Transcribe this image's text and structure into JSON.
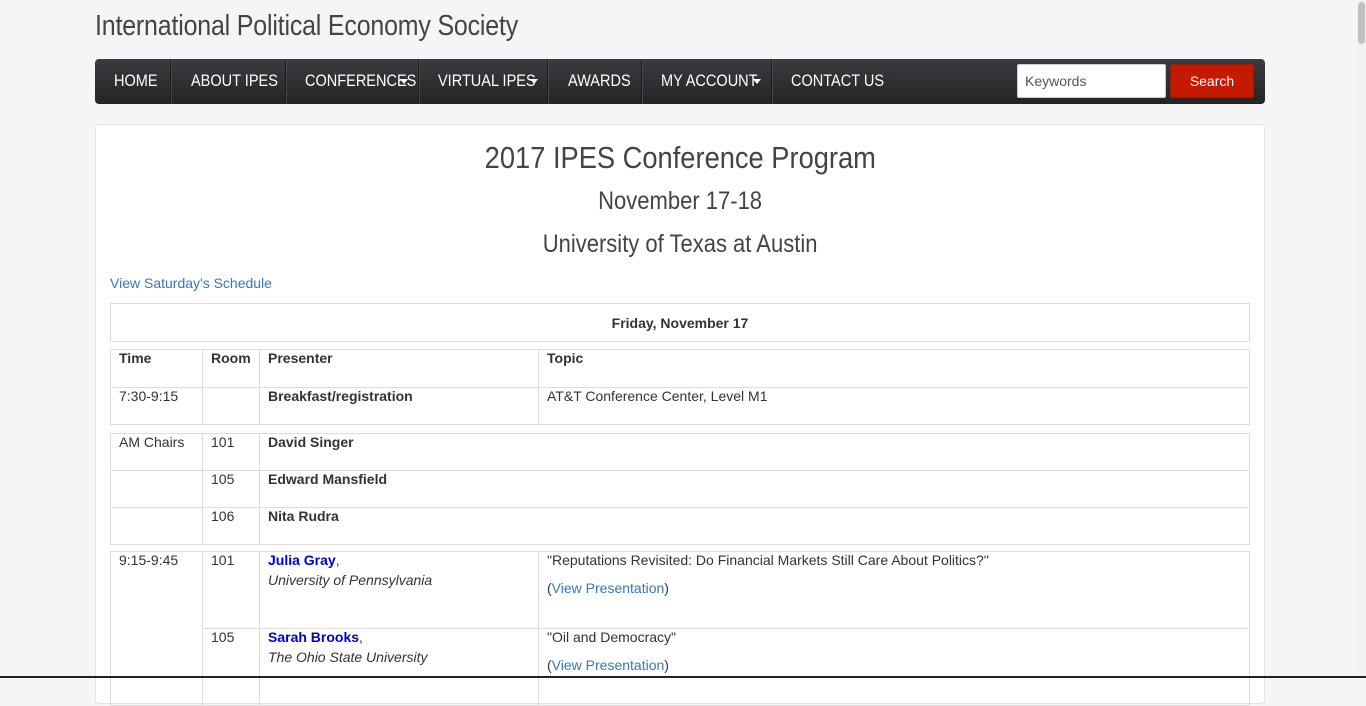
{
  "site": {
    "title": "International Political Economy Society"
  },
  "nav": {
    "items": [
      {
        "label": "HOME",
        "dropdown": false
      },
      {
        "label": "ABOUT IPES",
        "dropdown": false
      },
      {
        "label": "CONFERENCES",
        "dropdown": true
      },
      {
        "label": "VIRTUAL IPES",
        "dropdown": true
      },
      {
        "label": "AWARDS",
        "dropdown": false
      },
      {
        "label": "MY ACCOUNT",
        "dropdown": true
      },
      {
        "label": "CONTACT US",
        "dropdown": false
      }
    ],
    "search_placeholder": "Keywords",
    "search_label": "Search"
  },
  "page": {
    "title": "2017 IPES Conference Program",
    "dates": "November 17-18",
    "venue": "University of Texas at Austin",
    "saturday_link": "View Saturday's Schedule"
  },
  "schedule": {
    "day": "Friday, November 17",
    "headers": [
      "Time",
      "Room",
      "Presenter",
      "Topic"
    ],
    "breakfast": {
      "time": "7:30-9:15",
      "room": "",
      "presenter": "Breakfast/registration",
      "topic": "AT&T Conference Center, Level M1"
    },
    "chairs": {
      "label": "AM Chairs",
      "rows": [
        {
          "room": "101",
          "name": "David Singer"
        },
        {
          "room": "105",
          "name": "Edward Mansfield"
        },
        {
          "room": "106",
          "name": "Nita Rudra"
        }
      ]
    },
    "session": {
      "time": "9:15-9:45",
      "talks": [
        {
          "room": "101",
          "name": "Julia Gray",
          "affiliation": "University of Pennsylvania",
          "topic": "\"Reputations Revisited: Do Financial Markets Still Care About Politics?\"",
          "link": "View Presentation"
        },
        {
          "room": "105",
          "name": "Sarah Brooks",
          "affiliation": "The Ohio State University",
          "topic": "\"Oil and Democracy\"",
          "link": "View Presentation"
        }
      ]
    }
  },
  "colors": {
    "nav_bg": "#2b2d30",
    "search_button": "#c41a00",
    "link": "#337ab7",
    "presenter_link": "#0000cc"
  }
}
